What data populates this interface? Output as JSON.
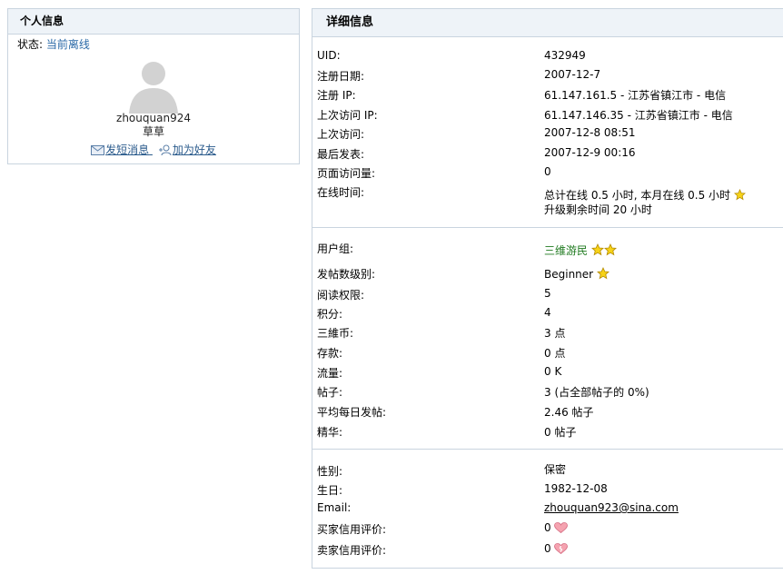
{
  "left": {
    "header": "个人信息",
    "status_label": "状态:",
    "status_value": "当前离线",
    "username": "zhouquan924",
    "nickname": "草草",
    "send_message_label": "发短消息",
    "add_friend_label": "加为好友"
  },
  "right": {
    "header": "详细信息",
    "section1": [
      {
        "label": "UID:",
        "value": "432949"
      },
      {
        "label": "注册日期:",
        "value": "2007-12-7"
      },
      {
        "label": "注册 IP:",
        "value": "61.147.161.5 - 江苏省镇江市 - 电信"
      },
      {
        "label": "上次访问 IP:",
        "value": "61.147.146.35 - 江苏省镇江市 - 电信"
      },
      {
        "label": "上次访问:",
        "value": "2007-12-8 08:51"
      },
      {
        "label": "最后发表:",
        "value": "2007-12-9 00:16"
      },
      {
        "label": "页面访问量:",
        "value": "0"
      },
      {
        "label": "在线时间:",
        "value": "总计在线 0.5 小时, 本月在线 0.5 小时",
        "value2": "升级剩余时间 20 小时"
      }
    ],
    "section2": [
      {
        "label": "用户组:",
        "value": "三维游民"
      },
      {
        "label": "发帖数级别:",
        "value": "Beginner"
      },
      {
        "label": "阅读权限:",
        "value": "5"
      },
      {
        "label": "积分:",
        "value": "4"
      },
      {
        "label": "三維币:",
        "value": "3 点"
      },
      {
        "label": "存款:",
        "value": "0 点"
      },
      {
        "label": "流量:",
        "value": "0 K"
      },
      {
        "label": "帖子:",
        "value": "3 (占全部帖子的 0%)"
      },
      {
        "label": "平均每日发帖:",
        "value": "2.46 帖子"
      },
      {
        "label": "精华:",
        "value": "0 帖子"
      }
    ],
    "section3": [
      {
        "label": "性别:",
        "value": "保密"
      },
      {
        "label": "生日:",
        "value": "1982-12-08"
      },
      {
        "label": "Email:",
        "value": "zhouquan923@sina.com"
      },
      {
        "label": "买家信用评价:",
        "value": "0"
      },
      {
        "label": "卖家信用评价:",
        "value": "0"
      }
    ]
  },
  "colors": {
    "accent_link": "#2b5b8c",
    "group_green": "#1f7a1f",
    "border": "#c9d4df",
    "header_bg": "#eef3f8"
  }
}
